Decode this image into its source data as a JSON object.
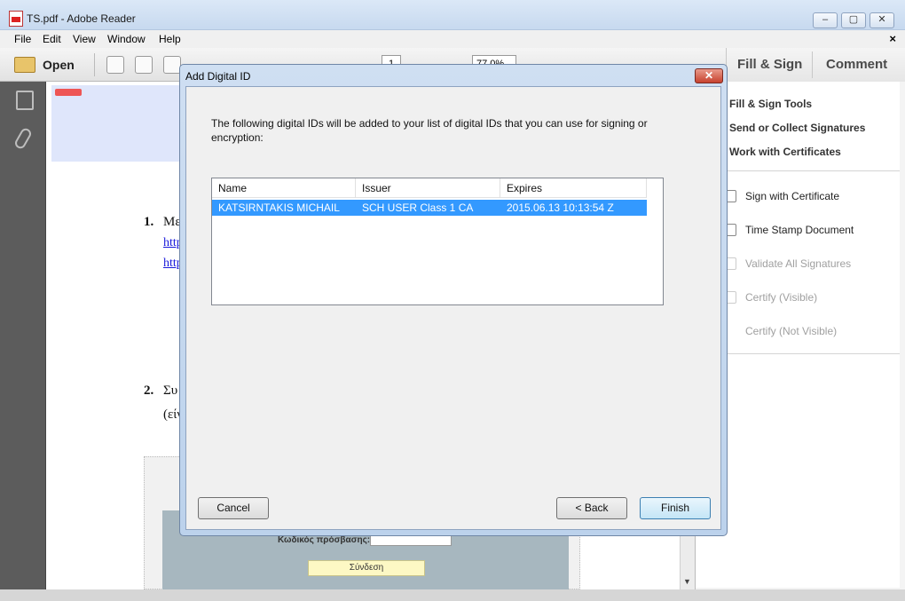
{
  "app": {
    "title": "TS.pdf - Adobe Reader",
    "window_buttons": [
      "–",
      "▢",
      "✕"
    ]
  },
  "menu": [
    "File",
    "Edit",
    "View",
    "Window",
    "Help"
  ],
  "doc_close": "×",
  "toolbar": {
    "open_label": "Open",
    "page_number": "1",
    "zoom": "77.0%"
  },
  "right_tabs": {
    "fill_sign": "Fill & Sign",
    "comment": "Comment"
  },
  "right_panel": {
    "sections": [
      "Fill & Sign Tools",
      "Send or Collect Signatures",
      "Work with Certificates"
    ],
    "items": [
      {
        "label": "Sign with Certificate",
        "enabled": true
      },
      {
        "label": "Time Stamp Document",
        "enabled": true
      },
      {
        "label": "Validate All Signatures",
        "enabled": false
      },
      {
        "label": "Certify (Visible)",
        "enabled": false
      },
      {
        "label": "Certify (Not Visible)",
        "enabled": false
      }
    ]
  },
  "document": {
    "item1_number": "1.",
    "item1_text": "Με",
    "link1": "http",
    "link2": "http",
    "item2_number": "2.",
    "item2_text": "Συ",
    "item2_sub": "(είν",
    "login_label": "Κωδικός πρόσβασης:",
    "login_button": "Σύνδεση"
  },
  "dialog": {
    "title": "Add Digital ID",
    "close": "✕",
    "message": "The following digital IDs will be added to your list of digital IDs that you can use for signing or encryption:",
    "columns": [
      "Name",
      "Issuer",
      "Expires"
    ],
    "rows": [
      {
        "name": "KATSIRNTAKIS MICHAIL",
        "issuer": "SCH USER Class 1 CA",
        "expires": "2015.06.13 10:13:54 Z"
      }
    ],
    "buttons": {
      "cancel": "Cancel",
      "back": "< Back",
      "finish": "Finish"
    }
  }
}
